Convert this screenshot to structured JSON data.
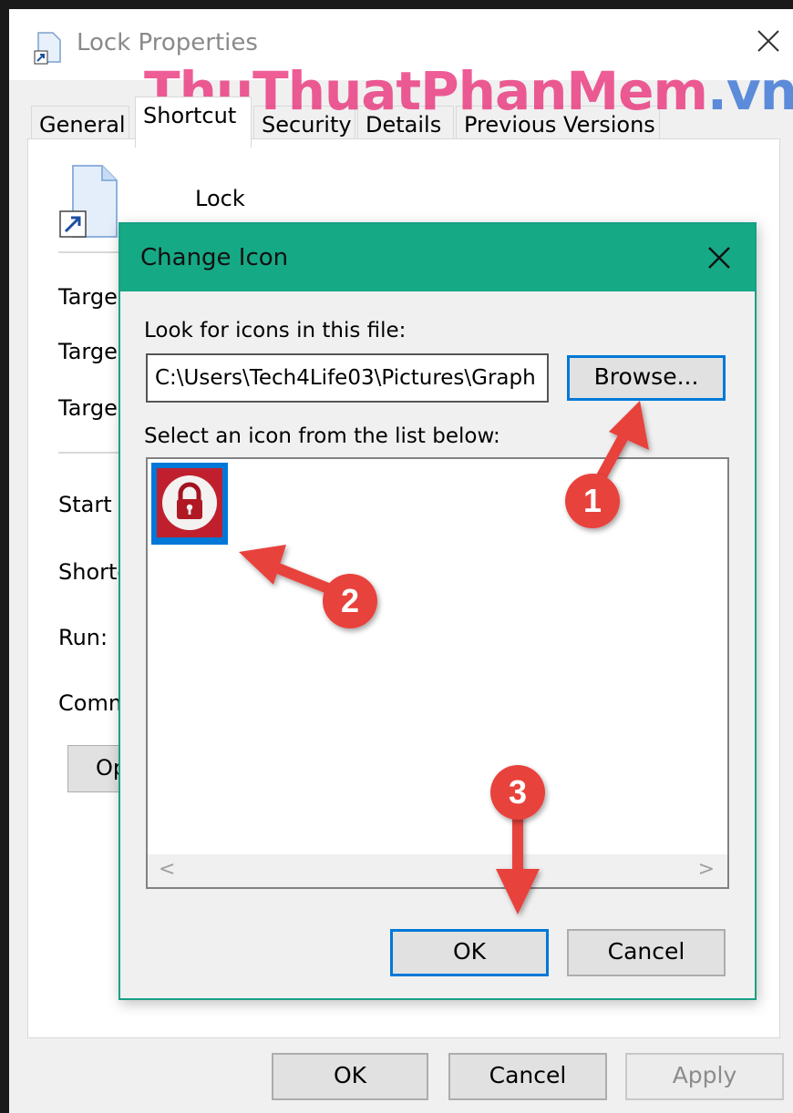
{
  "watermark": {
    "main": "ThuThuatPhanMem",
    "tld": ".vn"
  },
  "properties_window": {
    "title": "Lock Properties",
    "title_icon": "shortcut-file-icon",
    "close_icon": "close-icon",
    "tabs": [
      {
        "label": "General",
        "active": false
      },
      {
        "label": "Shortcut",
        "active": true
      },
      {
        "label": "Security",
        "active": false
      },
      {
        "label": "Details",
        "active": false
      },
      {
        "label": "Previous Versions",
        "active": false
      }
    ],
    "shortcut_name": "Lock",
    "row_labels": [
      "Targe",
      "Targe",
      "Targe",
      "Start i",
      "Shortc",
      "Run:",
      "Comm"
    ],
    "open_button_label": "Op",
    "buttons": {
      "ok": "OK",
      "cancel": "Cancel",
      "apply": "Apply"
    }
  },
  "change_icon_dialog": {
    "title": "Change Icon",
    "title_bar_color": "#16a985",
    "close_icon": "close-icon",
    "look_for_label": "Look for icons in this file:",
    "file_path": "C:\\Users\\Tech4Life03\\Pictures\\Graph",
    "browse_label": "Browse...",
    "select_label": "Select an icon from the list below:",
    "icons": [
      {
        "name": "red-padlock-icon",
        "selected": true
      }
    ],
    "scroll_left": "<",
    "scroll_right": ">",
    "ok_label": "OK",
    "cancel_label": "Cancel"
  },
  "annotations": {
    "step1": "1",
    "step2": "2",
    "step3": "3",
    "color": "#e8423c"
  }
}
